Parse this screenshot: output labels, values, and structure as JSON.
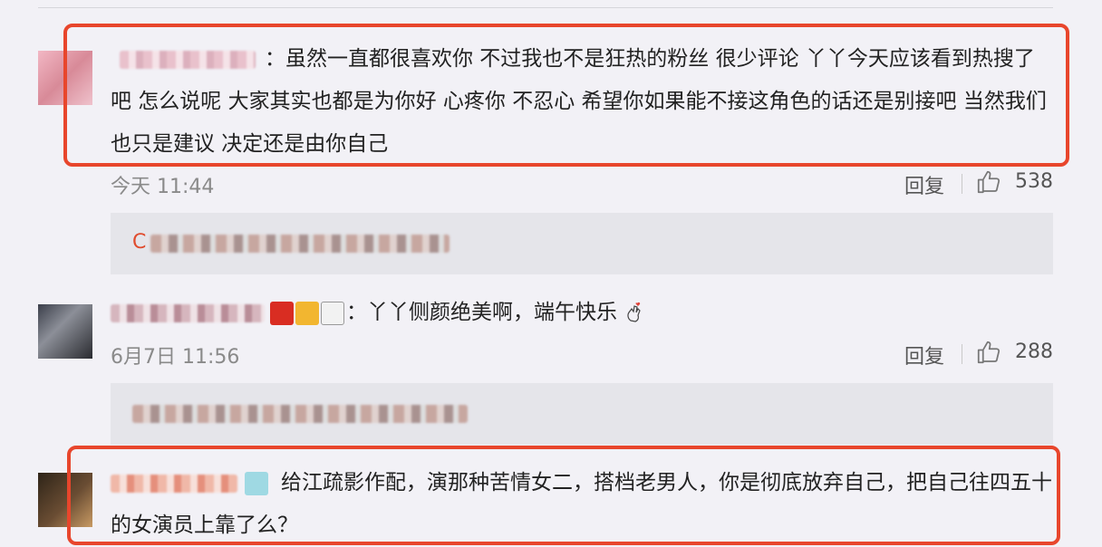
{
  "comments": [
    {
      "text": "：虽然一直都很喜欢你 不过我也不是狂热的粉丝 很少评论 丫丫今天应该看到热搜了吧 怎么说呢 大家其实也都是为你好 心疼你 不忍心 希望你如果能不接这角色的话还是别接吧 当然我们也只是建议 决定还是由你自己",
      "time": "今天 11:44",
      "reply_label": "回复",
      "like_count": "538",
      "reply_preview_lead": "C"
    },
    {
      "text": "：丫丫侧颜绝美啊，端午快乐",
      "time": "6月7日 11:56",
      "reply_label": "回复",
      "like_count": "288"
    },
    {
      "text": "给江疏影作配，演那种苦情女二，搭档老男人，你是彻底放弃自己，把自己往四五十的女演员上靠了么？"
    }
  ],
  "colors": {
    "highlight": "#e8462c",
    "background": "#f2f1f6",
    "reply_box": "#e5e5ea"
  },
  "icons": {
    "like": "thumbs-up-icon",
    "heart_hand": "finger-heart-icon"
  }
}
